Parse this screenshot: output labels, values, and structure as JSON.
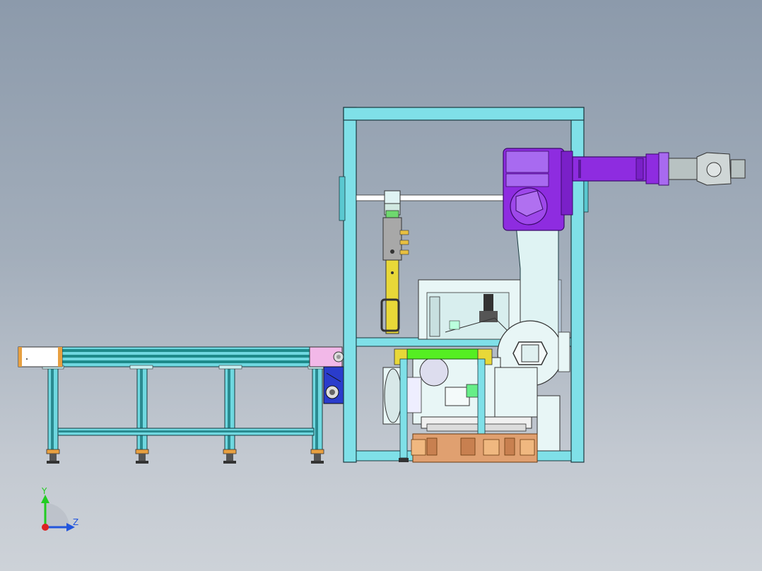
{
  "viewport": {
    "background_top": "#8c9aab",
    "background_bottom": "#cdd2d8"
  },
  "triad": {
    "y_label": "Y",
    "z_label": "Z",
    "y_color": "#22cc22",
    "z_color": "#2255dd",
    "origin_color": "#dd2222"
  },
  "colors": {
    "frame": "#7fe0e8",
    "frame_edge": "#1a3a40",
    "robot": "#8e2ce0",
    "robot_dark": "#5a1a9a",
    "robot_arm_light": "#dff3f3",
    "wrist": "#b8c2c2",
    "gripper": "#e8d838",
    "conveyor_end": "#ffffff",
    "conveyor_rail": "#1e8a8a",
    "conveyor_post": "#6fd8e0",
    "pink_block": "#f2b8e8",
    "motor_blue": "#2a3ccc",
    "green_bar": "#55ee22",
    "orange_base": "#e0a070",
    "machine_light": "#e8f6f6"
  }
}
